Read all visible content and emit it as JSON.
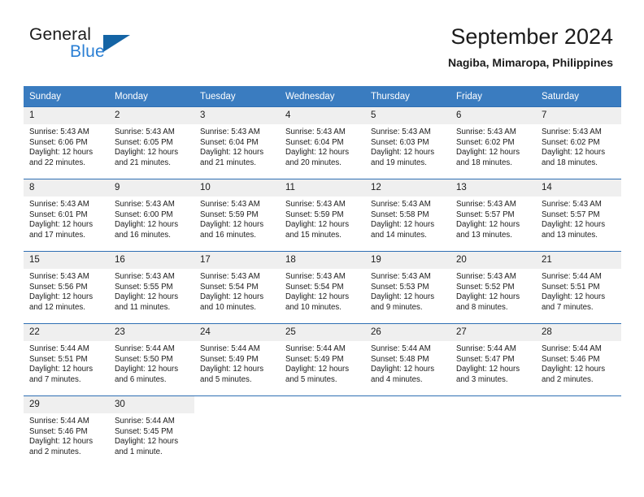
{
  "brand": {
    "name_part1": "General",
    "name_part2": "Blue",
    "flag_icon": "triangle-flag-icon"
  },
  "header": {
    "title": "September 2024",
    "subtitle": "Nagiba, Mimaropa, Philippines"
  },
  "colors": {
    "header_blue": "#3a7cc0",
    "row_border_blue": "#2f6fb3",
    "daynum_bg": "#efefef",
    "brand_blue": "#2a7fd4",
    "flag_blue": "#1464a5",
    "text": "#1b1b1b"
  },
  "weekdays": [
    "Sunday",
    "Monday",
    "Tuesday",
    "Wednesday",
    "Thursday",
    "Friday",
    "Saturday"
  ],
  "labels": {
    "sunrise_prefix": "Sunrise:",
    "sunset_prefix": "Sunset:",
    "daylight_prefix": "Daylight:"
  },
  "weeks": [
    [
      {
        "day": "1",
        "sunrise": "Sunrise: 5:43 AM",
        "sunset": "Sunset: 6:06 PM",
        "daylight1": "Daylight: 12 hours",
        "daylight2": "and 22 minutes."
      },
      {
        "day": "2",
        "sunrise": "Sunrise: 5:43 AM",
        "sunset": "Sunset: 6:05 PM",
        "daylight1": "Daylight: 12 hours",
        "daylight2": "and 21 minutes."
      },
      {
        "day": "3",
        "sunrise": "Sunrise: 5:43 AM",
        "sunset": "Sunset: 6:04 PM",
        "daylight1": "Daylight: 12 hours",
        "daylight2": "and 21 minutes."
      },
      {
        "day": "4",
        "sunrise": "Sunrise: 5:43 AM",
        "sunset": "Sunset: 6:04 PM",
        "daylight1": "Daylight: 12 hours",
        "daylight2": "and 20 minutes."
      },
      {
        "day": "5",
        "sunrise": "Sunrise: 5:43 AM",
        "sunset": "Sunset: 6:03 PM",
        "daylight1": "Daylight: 12 hours",
        "daylight2": "and 19 minutes."
      },
      {
        "day": "6",
        "sunrise": "Sunrise: 5:43 AM",
        "sunset": "Sunset: 6:02 PM",
        "daylight1": "Daylight: 12 hours",
        "daylight2": "and 18 minutes."
      },
      {
        "day": "7",
        "sunrise": "Sunrise: 5:43 AM",
        "sunset": "Sunset: 6:02 PM",
        "daylight1": "Daylight: 12 hours",
        "daylight2": "and 18 minutes."
      }
    ],
    [
      {
        "day": "8",
        "sunrise": "Sunrise: 5:43 AM",
        "sunset": "Sunset: 6:01 PM",
        "daylight1": "Daylight: 12 hours",
        "daylight2": "and 17 minutes."
      },
      {
        "day": "9",
        "sunrise": "Sunrise: 5:43 AM",
        "sunset": "Sunset: 6:00 PM",
        "daylight1": "Daylight: 12 hours",
        "daylight2": "and 16 minutes."
      },
      {
        "day": "10",
        "sunrise": "Sunrise: 5:43 AM",
        "sunset": "Sunset: 5:59 PM",
        "daylight1": "Daylight: 12 hours",
        "daylight2": "and 16 minutes."
      },
      {
        "day": "11",
        "sunrise": "Sunrise: 5:43 AM",
        "sunset": "Sunset: 5:59 PM",
        "daylight1": "Daylight: 12 hours",
        "daylight2": "and 15 minutes."
      },
      {
        "day": "12",
        "sunrise": "Sunrise: 5:43 AM",
        "sunset": "Sunset: 5:58 PM",
        "daylight1": "Daylight: 12 hours",
        "daylight2": "and 14 minutes."
      },
      {
        "day": "13",
        "sunrise": "Sunrise: 5:43 AM",
        "sunset": "Sunset: 5:57 PM",
        "daylight1": "Daylight: 12 hours",
        "daylight2": "and 13 minutes."
      },
      {
        "day": "14",
        "sunrise": "Sunrise: 5:43 AM",
        "sunset": "Sunset: 5:57 PM",
        "daylight1": "Daylight: 12 hours",
        "daylight2": "and 13 minutes."
      }
    ],
    [
      {
        "day": "15",
        "sunrise": "Sunrise: 5:43 AM",
        "sunset": "Sunset: 5:56 PM",
        "daylight1": "Daylight: 12 hours",
        "daylight2": "and 12 minutes."
      },
      {
        "day": "16",
        "sunrise": "Sunrise: 5:43 AM",
        "sunset": "Sunset: 5:55 PM",
        "daylight1": "Daylight: 12 hours",
        "daylight2": "and 11 minutes."
      },
      {
        "day": "17",
        "sunrise": "Sunrise: 5:43 AM",
        "sunset": "Sunset: 5:54 PM",
        "daylight1": "Daylight: 12 hours",
        "daylight2": "and 10 minutes."
      },
      {
        "day": "18",
        "sunrise": "Sunrise: 5:43 AM",
        "sunset": "Sunset: 5:54 PM",
        "daylight1": "Daylight: 12 hours",
        "daylight2": "and 10 minutes."
      },
      {
        "day": "19",
        "sunrise": "Sunrise: 5:43 AM",
        "sunset": "Sunset: 5:53 PM",
        "daylight1": "Daylight: 12 hours",
        "daylight2": "and 9 minutes."
      },
      {
        "day": "20",
        "sunrise": "Sunrise: 5:43 AM",
        "sunset": "Sunset: 5:52 PM",
        "daylight1": "Daylight: 12 hours",
        "daylight2": "and 8 minutes."
      },
      {
        "day": "21",
        "sunrise": "Sunrise: 5:44 AM",
        "sunset": "Sunset: 5:51 PM",
        "daylight1": "Daylight: 12 hours",
        "daylight2": "and 7 minutes."
      }
    ],
    [
      {
        "day": "22",
        "sunrise": "Sunrise: 5:44 AM",
        "sunset": "Sunset: 5:51 PM",
        "daylight1": "Daylight: 12 hours",
        "daylight2": "and 7 minutes."
      },
      {
        "day": "23",
        "sunrise": "Sunrise: 5:44 AM",
        "sunset": "Sunset: 5:50 PM",
        "daylight1": "Daylight: 12 hours",
        "daylight2": "and 6 minutes."
      },
      {
        "day": "24",
        "sunrise": "Sunrise: 5:44 AM",
        "sunset": "Sunset: 5:49 PM",
        "daylight1": "Daylight: 12 hours",
        "daylight2": "and 5 minutes."
      },
      {
        "day": "25",
        "sunrise": "Sunrise: 5:44 AM",
        "sunset": "Sunset: 5:49 PM",
        "daylight1": "Daylight: 12 hours",
        "daylight2": "and 5 minutes."
      },
      {
        "day": "26",
        "sunrise": "Sunrise: 5:44 AM",
        "sunset": "Sunset: 5:48 PM",
        "daylight1": "Daylight: 12 hours",
        "daylight2": "and 4 minutes."
      },
      {
        "day": "27",
        "sunrise": "Sunrise: 5:44 AM",
        "sunset": "Sunset: 5:47 PM",
        "daylight1": "Daylight: 12 hours",
        "daylight2": "and 3 minutes."
      },
      {
        "day": "28",
        "sunrise": "Sunrise: 5:44 AM",
        "sunset": "Sunset: 5:46 PM",
        "daylight1": "Daylight: 12 hours",
        "daylight2": "and 2 minutes."
      }
    ],
    [
      {
        "day": "29",
        "sunrise": "Sunrise: 5:44 AM",
        "sunset": "Sunset: 5:46 PM",
        "daylight1": "Daylight: 12 hours",
        "daylight2": "and 2 minutes."
      },
      {
        "day": "30",
        "sunrise": "Sunrise: 5:44 AM",
        "sunset": "Sunset: 5:45 PM",
        "daylight1": "Daylight: 12 hours",
        "daylight2": "and 1 minute."
      },
      {
        "day": "",
        "sunrise": "",
        "sunset": "",
        "daylight1": "",
        "daylight2": ""
      },
      {
        "day": "",
        "sunrise": "",
        "sunset": "",
        "daylight1": "",
        "daylight2": ""
      },
      {
        "day": "",
        "sunrise": "",
        "sunset": "",
        "daylight1": "",
        "daylight2": ""
      },
      {
        "day": "",
        "sunrise": "",
        "sunset": "",
        "daylight1": "",
        "daylight2": ""
      },
      {
        "day": "",
        "sunrise": "",
        "sunset": "",
        "daylight1": "",
        "daylight2": ""
      }
    ]
  ]
}
